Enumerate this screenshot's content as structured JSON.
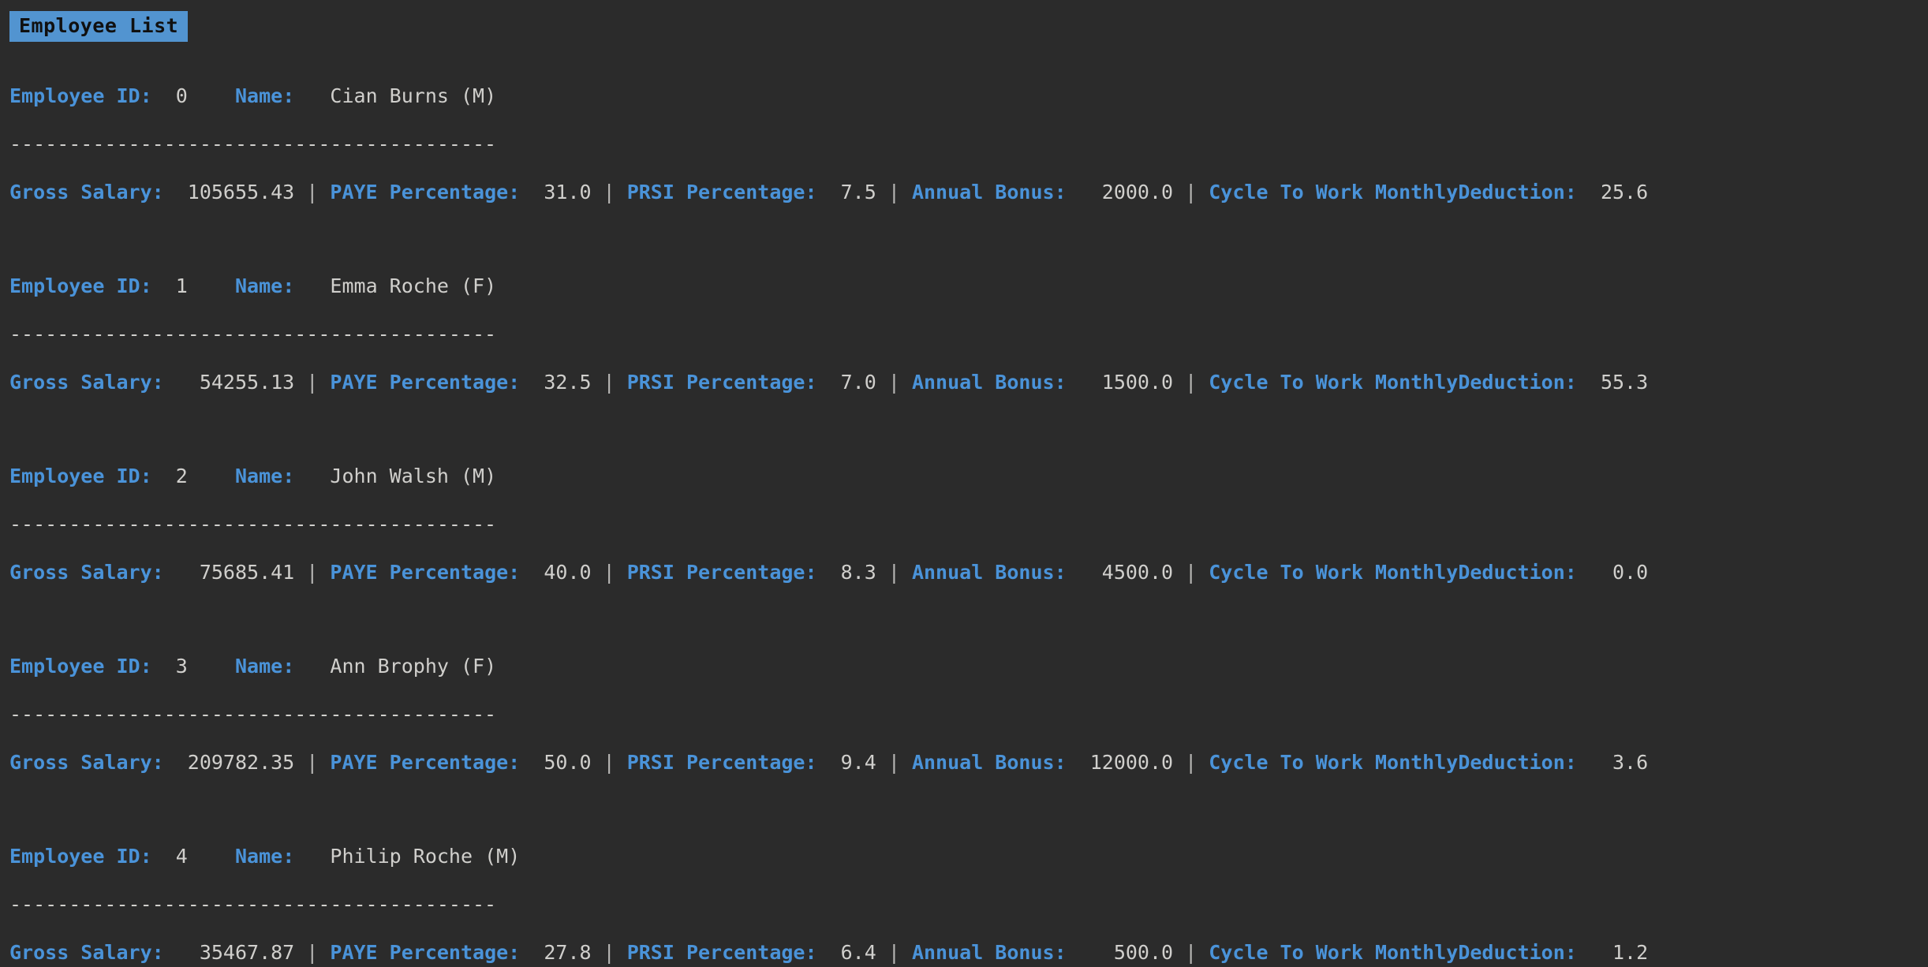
{
  "window": {
    "background_color": "#2b2b2b",
    "label_color": "#4a93d9",
    "value_color": "#d0cfcc",
    "badge_background": "#5294d0",
    "badge_text_color": "#101010"
  },
  "header": {
    "title": "Employee List"
  },
  "labels": {
    "employee_id": "Employee ID:",
    "name": "Name:",
    "gross_salary": "Gross Salary:",
    "paye_percentage": "PAYE Percentage:",
    "prsi_percentage": "PRSI Percentage:",
    "annual_bonus": "Annual Bonus:",
    "cycle_to_work": "Cycle To Work MonthlyDeduction:",
    "separator": "-----------------------------------------",
    "divider": "|"
  },
  "employees": [
    {
      "id": "0",
      "name": "Cian Burns (M)",
      "gross_salary": "105655.43",
      "paye_percentage": "31.0",
      "prsi_percentage": "7.5",
      "annual_bonus": "2000.0",
      "cycle_to_work_monthly_deduction": "25.6"
    },
    {
      "id": "1",
      "name": "Emma Roche (F)",
      "gross_salary": "54255.13",
      "paye_percentage": "32.5",
      "prsi_percentage": "7.0",
      "annual_bonus": "1500.0",
      "cycle_to_work_monthly_deduction": "55.3"
    },
    {
      "id": "2",
      "name": "John Walsh (M)",
      "gross_salary": "75685.41",
      "paye_percentage": "40.0",
      "prsi_percentage": "8.3",
      "annual_bonus": "4500.0",
      "cycle_to_work_monthly_deduction": "0.0"
    },
    {
      "id": "3",
      "name": "Ann Brophy (F)",
      "gross_salary": "209782.35",
      "paye_percentage": "50.0",
      "prsi_percentage": "9.4",
      "annual_bonus": "12000.0",
      "cycle_to_work_monthly_deduction": "3.6"
    },
    {
      "id": "4",
      "name": "Philip Roche (M)",
      "gross_salary": "35467.87",
      "paye_percentage": "27.8",
      "prsi_percentage": "6.4",
      "annual_bonus": "500.0",
      "cycle_to_work_monthly_deduction": "1.2"
    }
  ]
}
